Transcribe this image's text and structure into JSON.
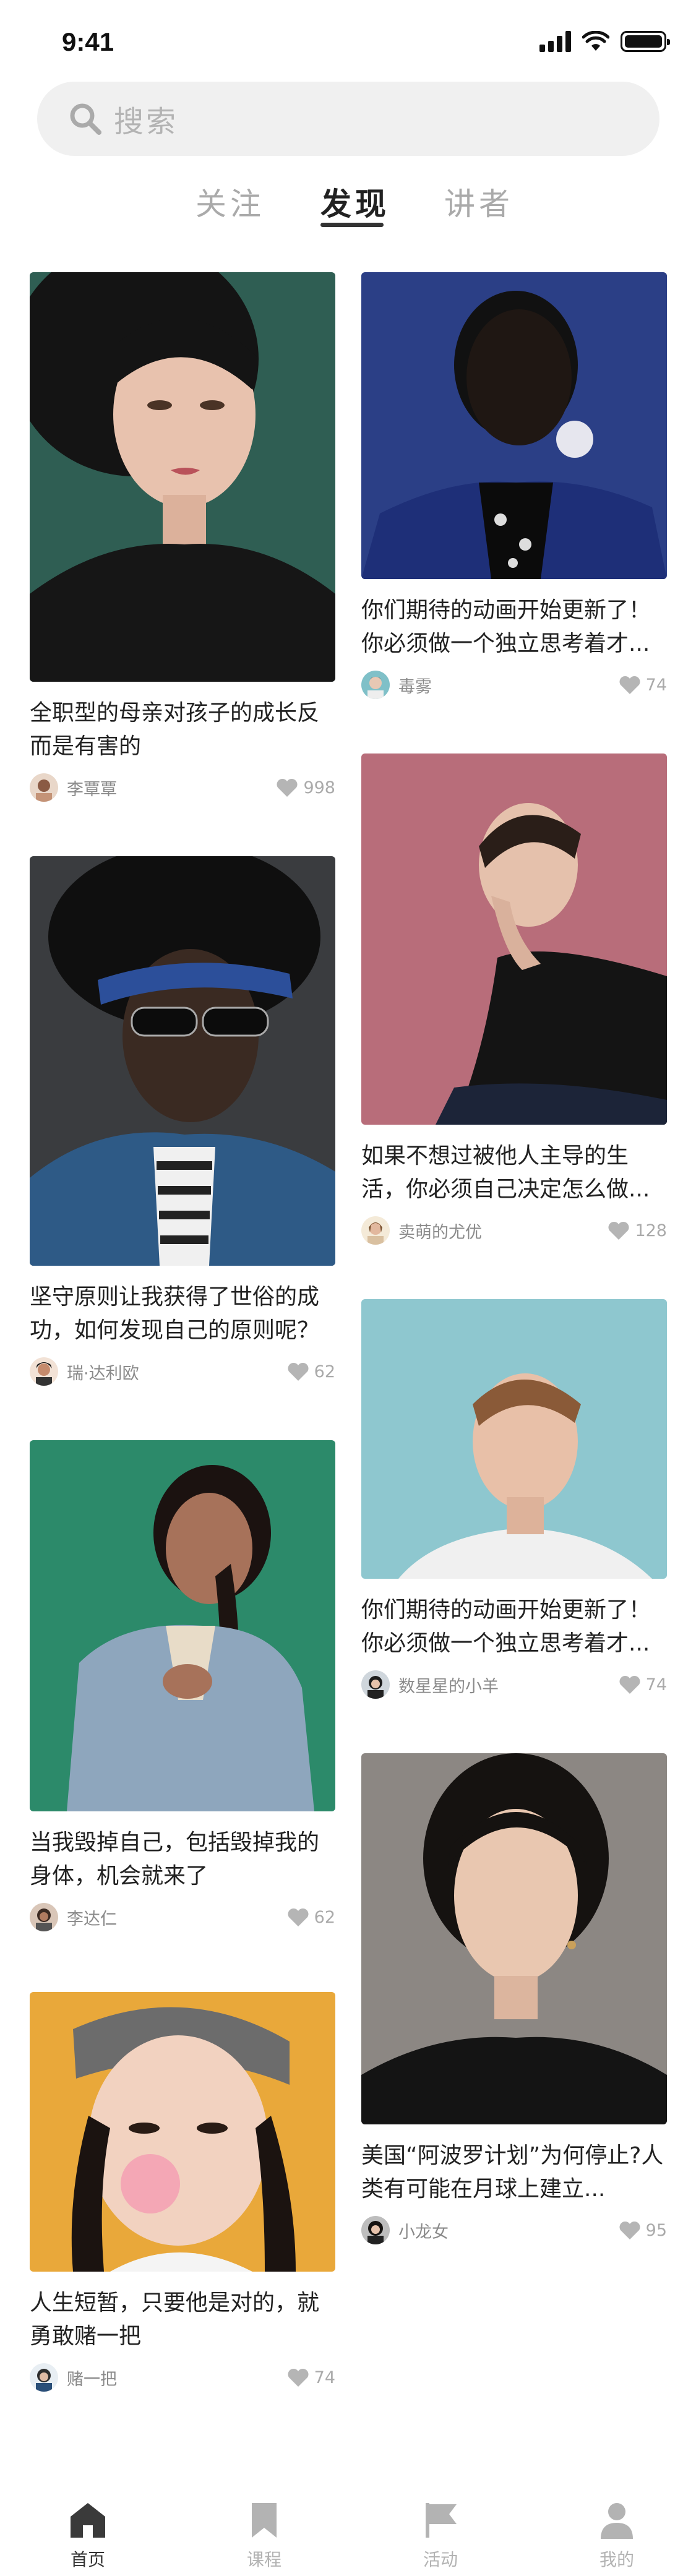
{
  "status": {
    "time": "9:41"
  },
  "search": {
    "placeholder": "搜索"
  },
  "tabs": [
    {
      "label": "关注",
      "active": false
    },
    {
      "label": "发现",
      "active": true
    },
    {
      "label": "讲者",
      "active": false
    }
  ],
  "feed": {
    "left": [
      {
        "title": "全职型的母亲对孩子的成长反而是有害的",
        "author": "李覃覃",
        "likes": "998",
        "photo": "woman-dark-hair-teal-background"
      },
      {
        "title": "坚守原则让我获得了世俗的成功，如何发现自己的原则呢？",
        "author": "瑞·达利欧",
        "likes": "62",
        "photo": "man-sunglasses-blue-headband"
      },
      {
        "title": "当我毁掉自己，包括毁掉我的身体，机会就来了",
        "author": "李达仁",
        "likes": "62",
        "photo": "woman-braid-green-background"
      },
      {
        "title": "人生短暂，只要他是对的，就勇敢赌一把",
        "author": "赌一把",
        "likes": "74",
        "photo": "woman-bubblegum-yellow-background"
      }
    ],
    "right": [
      {
        "title": "你们期待的动画开始更新了！你必须做一个独立思考着才...",
        "author": "毒雾",
        "likes": "74",
        "photo": "man-bubblegum-blue-background"
      },
      {
        "title": "如果不想过被他人主导的生活，你必须自己决定怎么做...",
        "author": "卖萌的尤优",
        "likes": "128",
        "photo": "man-black-turtleneck-pink-background"
      },
      {
        "title": "你们期待的动画开始更新了！你必须做一个独立思考着才...",
        "author": "数星星的小羊",
        "likes": "74",
        "photo": "man-looking-down-teal-background"
      },
      {
        "title": "美国“阿波罗计划”为何停止?人类有可能在月球上建立...",
        "author": "小龙女",
        "likes": "95",
        "photo": "woman-earrings-grey-background"
      }
    ]
  },
  "tabbar": [
    {
      "label": "首页",
      "icon": "home-icon",
      "active": true
    },
    {
      "label": "课程",
      "icon": "bookmark-icon",
      "active": false
    },
    {
      "label": "活动",
      "icon": "flag-icon",
      "active": false
    },
    {
      "label": "我的",
      "icon": "person-icon",
      "active": false
    }
  ],
  "colors": {
    "accent": "#333333",
    "muted": "#aaaaaa",
    "search_bg": "#f0f0f0"
  }
}
